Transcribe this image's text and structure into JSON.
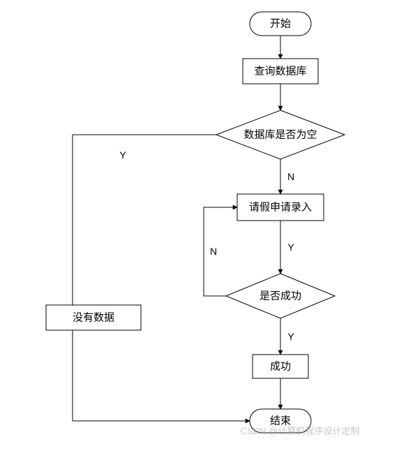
{
  "nodes": {
    "start": "开始",
    "query_db": "查询数据库",
    "db_empty": "数据库是否为空",
    "enter_leave": "请假申请录入",
    "is_success": "是否成功",
    "no_data": "没有数据",
    "success": "成功",
    "end": "结束"
  },
  "edges": {
    "db_empty_yes": "Y",
    "db_empty_no": "N",
    "enter_leave_yes": "Y",
    "is_success_no": "N",
    "is_success_yes": "Y"
  },
  "watermark": "CSDN @计算机程序设计定制"
}
